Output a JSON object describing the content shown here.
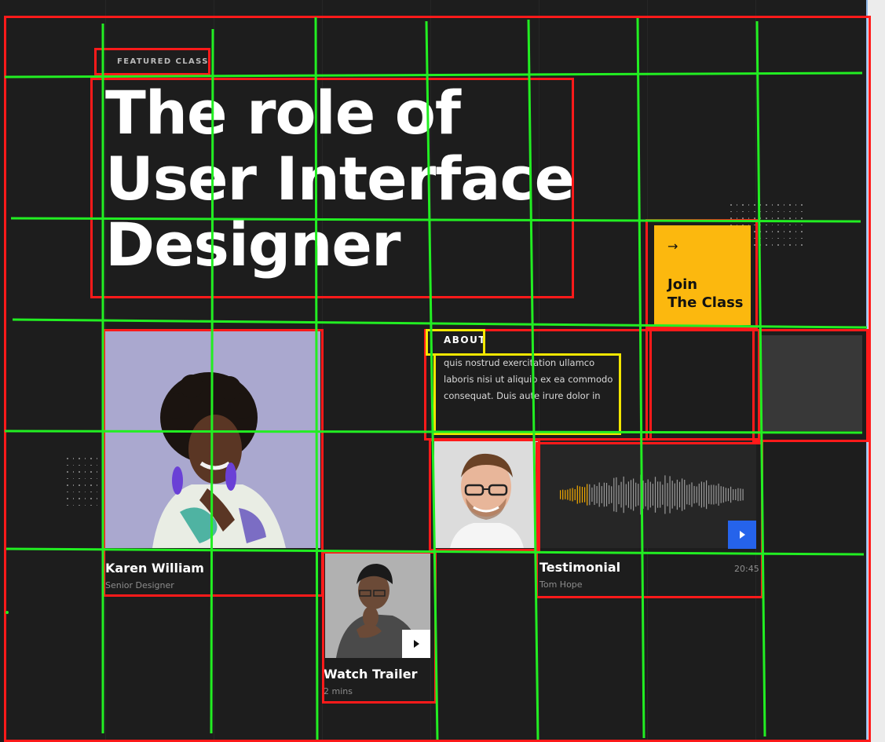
{
  "hero": {
    "eyebrow": "FEATURED CLASS",
    "title": "The role of\nUser Interface\nDesigner"
  },
  "join": {
    "arrow_icon": "arrow-right-icon",
    "label": "Join\nThe Class",
    "color": "#fcb80e"
  },
  "about": {
    "tag": "ABOUT",
    "text": "quis nostrud exercitation ullamco\nlaboris nisi ut aliquip ex ea commodo\nconsequat. Duis aute irure dolor in"
  },
  "profile": {
    "name": "Karen William",
    "role": "Senior Designer"
  },
  "testimonial": {
    "title": "Testimonial",
    "author": "Tom Hope",
    "duration": "20:45",
    "play_icon": "play-icon",
    "button_color": "#2563eb",
    "wave_color_played": "#f2a900",
    "wave_color_rest": "#9a9a9a"
  },
  "trailer": {
    "title": "Watch Trailer",
    "length": "2 mins",
    "play_icon": "play-icon"
  },
  "annotation_colors": {
    "box_red": "#ff1a1a",
    "box_yellow": "#f2e600",
    "grid_green": "#22ee22"
  }
}
